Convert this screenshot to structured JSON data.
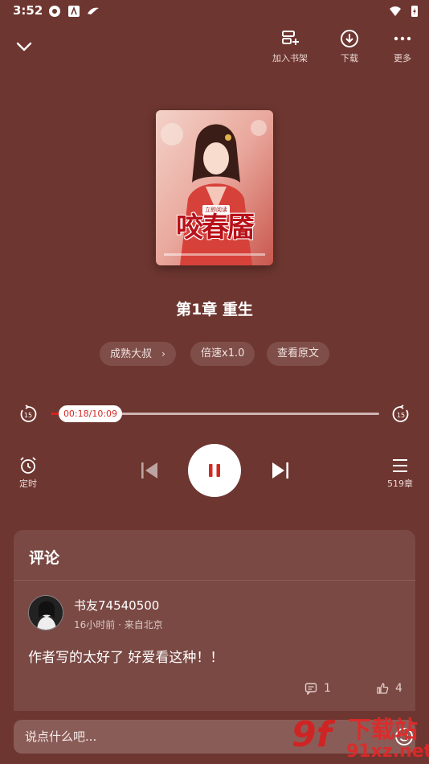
{
  "status_bar": {
    "time": "3:52"
  },
  "top_bar": {
    "actions": [
      {
        "label": "加入书架",
        "icon": "add-to-shelf-icon"
      },
      {
        "label": "下载",
        "icon": "download-icon"
      },
      {
        "label": "更多",
        "icon": "more-icon"
      }
    ]
  },
  "book": {
    "cover_title": "咬春靥",
    "cover_badge": "立即阅读"
  },
  "chapter": {
    "title": "第1章 重生"
  },
  "chips": {
    "narrator": "成熟大叔",
    "speed": "倍速x1.0",
    "original": "查看原文"
  },
  "player": {
    "time_display": "00:18/10:09",
    "progress_fraction": 0.03,
    "skip_back_seconds": "15",
    "skip_forward_seconds": "15",
    "timer_label": "定时",
    "chapters_label": "519章"
  },
  "comments": {
    "header": "评论",
    "items": [
      {
        "username": "书友74540500",
        "meta": "16小时前 · 来自北京",
        "text": "作者写的太好了 好爱看这种！！",
        "replies": "1",
        "likes": "4"
      }
    ]
  },
  "input": {
    "placeholder": "说点什么吧..."
  },
  "watermark": {
    "mark": "9f",
    "brand": "下载站",
    "domain": "91xz.net"
  },
  "colors": {
    "background": "#6e3630",
    "accent": "#d32a24",
    "card": "#7a4944"
  }
}
